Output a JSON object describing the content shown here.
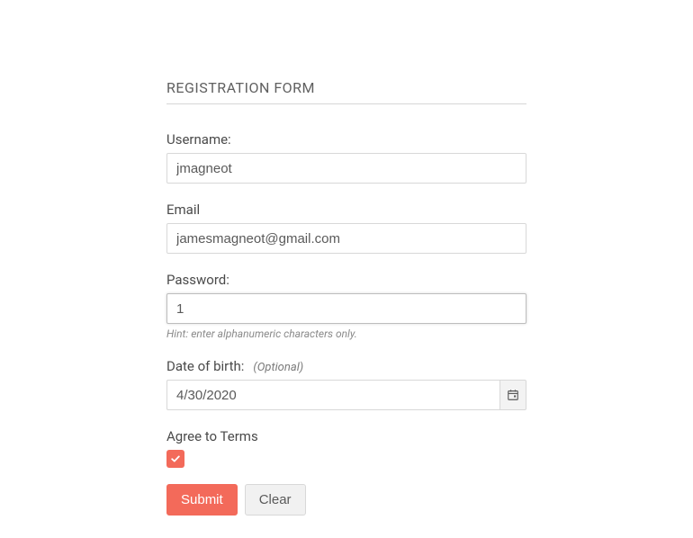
{
  "form": {
    "title": "REGISTRATION FORM",
    "username": {
      "label": "Username:",
      "value": "jmagneot"
    },
    "email": {
      "label": "Email",
      "value": "jamesmagneot@gmail.com"
    },
    "password": {
      "label": "Password:",
      "value": "1",
      "hint": "Hint: enter alphanumeric characters only."
    },
    "dob": {
      "label": "Date of birth:",
      "optional_text": "(Optional)",
      "value": "4/30/2020"
    },
    "terms": {
      "label": "Agree to Terms",
      "checked": true
    },
    "buttons": {
      "submit": "Submit",
      "clear": "Clear"
    }
  }
}
